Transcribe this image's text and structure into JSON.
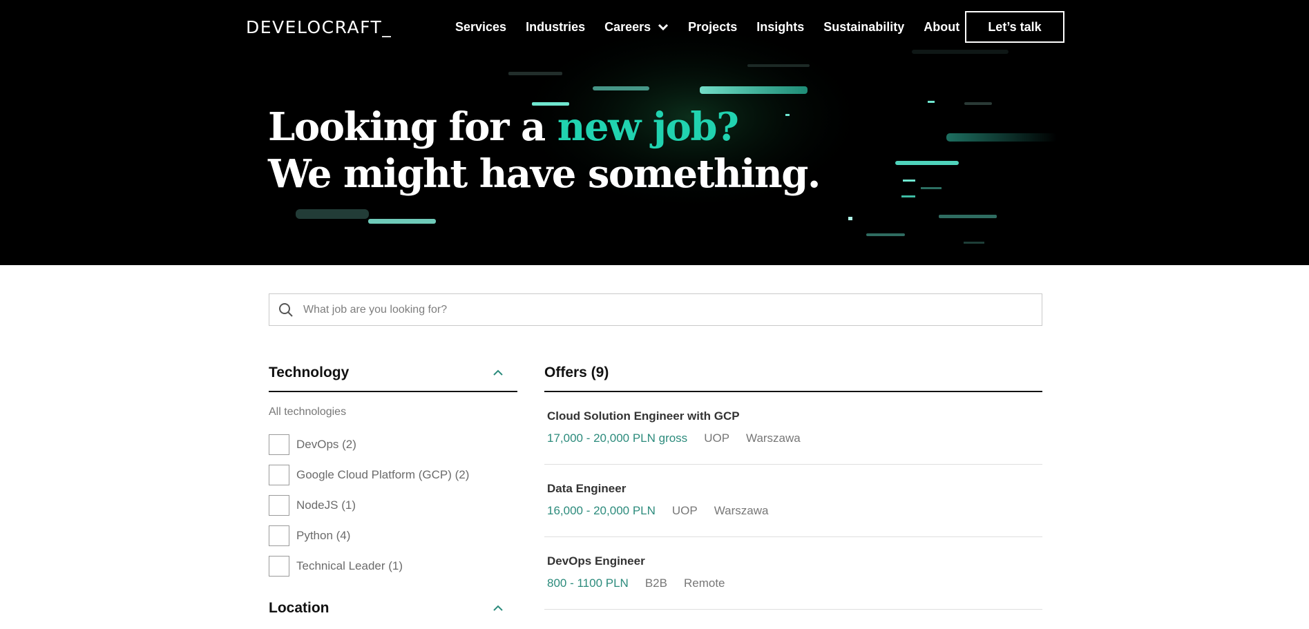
{
  "brand": {
    "logo": "DEVELOCRAFT_"
  },
  "colors": {
    "accent": "#21d3b0",
    "salary": "#2c8b7c",
    "hero_bg": "#000000"
  },
  "nav": {
    "items": [
      {
        "label": "Services"
      },
      {
        "label": "Industries"
      },
      {
        "label": "Careers",
        "icon": "chevron-down-icon"
      },
      {
        "label": "Projects"
      },
      {
        "label": "Insights"
      },
      {
        "label": "Sustainability"
      },
      {
        "label": "About"
      }
    ],
    "cta_label": "Let’s talk"
  },
  "hero": {
    "line1_prefix": "Looking for a ",
    "line1_accent": "new job?",
    "line2": "We might have something."
  },
  "search": {
    "placeholder": "What job are you looking for?",
    "value": "",
    "icon": "search-icon"
  },
  "filters": {
    "technology": {
      "title": "Technology",
      "all_label": "All technologies",
      "options": [
        {
          "label": "DevOps (2)",
          "checked": false
        },
        {
          "label": "Google Cloud Platform (GCP) (2)",
          "checked": false
        },
        {
          "label": "NodeJS (1)",
          "checked": false
        },
        {
          "label": "Python (4)",
          "checked": false
        },
        {
          "label": "Technical Leader (1)",
          "checked": false
        }
      ]
    },
    "location": {
      "title": "Location"
    }
  },
  "offers": {
    "heading": "Offers (9)",
    "items": [
      {
        "title": "Cloud Solution Engineer with GCP",
        "salary": "17,000 - 20,000 PLN gross",
        "contract": "UOP",
        "location": "Warszawa"
      },
      {
        "title": "Data Engineer",
        "salary": "16,000 - 20,000 PLN",
        "contract": "UOP",
        "location": "Warszawa"
      },
      {
        "title": "DevOps Engineer",
        "salary": "800 - 1100 PLN",
        "contract": "B2B",
        "location": "Remote"
      }
    ]
  }
}
